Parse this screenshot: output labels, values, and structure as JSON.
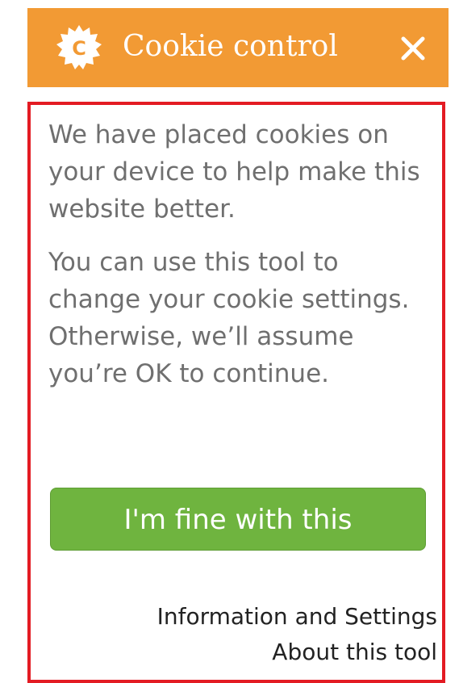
{
  "header": {
    "title": "Cookie control",
    "logo_icon": "cookie-gear-icon",
    "close_icon": "close-icon",
    "background_color": "#f29a34"
  },
  "body": {
    "paragraph_1": "We have placed cookies on your device to help make this website better.",
    "paragraph_2": "You can use this tool to change your cookie settings. Otherwise, we’ll assume you’re OK to continue.",
    "accept_button_label": "I'm fine with this",
    "accept_button_color": "#6fb43f",
    "info_settings_link": "Information and Settings",
    "about_tool_link": "About this tool",
    "highlight_border_color": "#e31b23"
  }
}
